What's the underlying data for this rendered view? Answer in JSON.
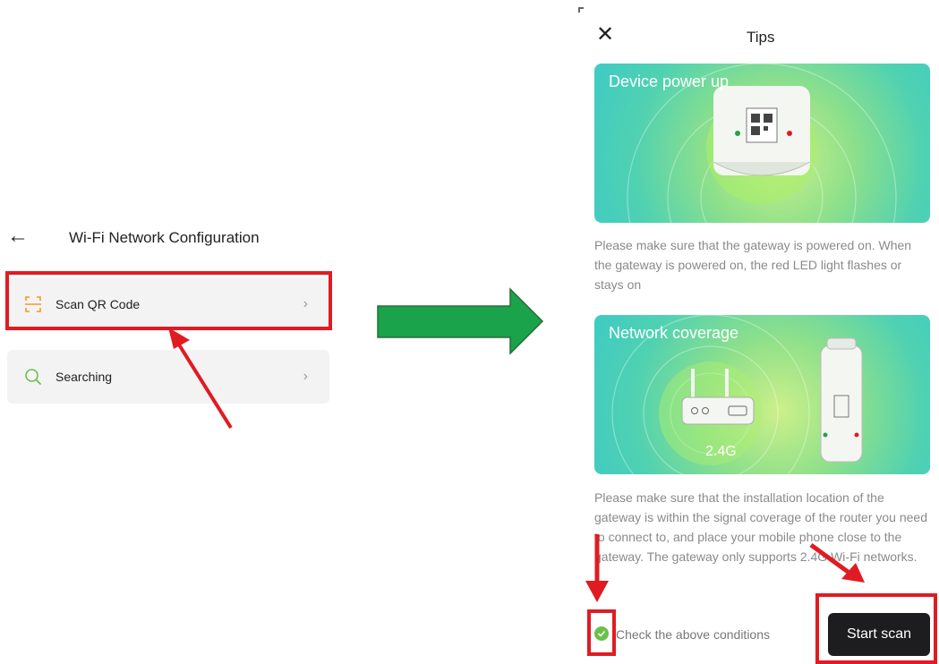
{
  "left_screen": {
    "title": "Wi-Fi Network Configuration",
    "items": [
      {
        "label": "Scan QR Code"
      },
      {
        "label": "Searching"
      }
    ]
  },
  "right_screen": {
    "title": "Tips",
    "cards": [
      {
        "title": "Device power up",
        "text": "Please make sure that the gateway is powered on. When the gateway is powered on, the red LED light flashes or stays on"
      },
      {
        "title": "Network coverage",
        "band_label": "2.4G",
        "text": "Please make sure that the installation location of the gateway is within the signal coverage of the router you need to connect to, and place your mobile phone close to the gateway. The gateway only supports 2.4G Wi-Fi networks."
      }
    ],
    "check_label": "Check the above conditions",
    "start_button": "Start scan"
  },
  "colors": {
    "highlight": "#e01b22",
    "arrow": "#1aa34a",
    "accent": "#f29b21",
    "check": "#6cc04a"
  }
}
